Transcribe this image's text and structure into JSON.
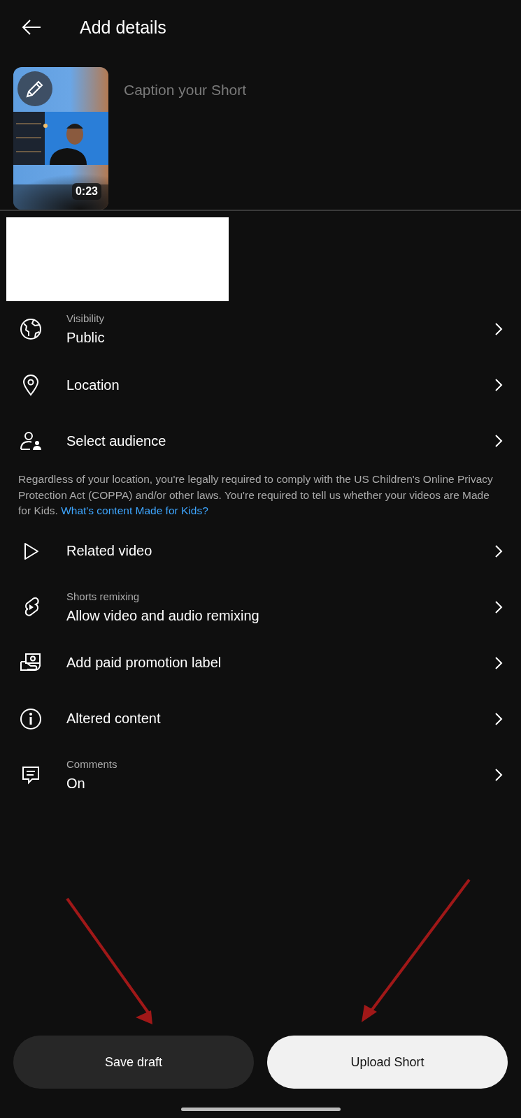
{
  "header": {
    "title": "Add details"
  },
  "video": {
    "kind": "picture",
    "duration": "0:23"
  },
  "caption": {
    "placeholder": "Caption your Short"
  },
  "settings": [
    {
      "label": "Visibility",
      "value": "Public"
    },
    {
      "value": "Location"
    },
    {
      "value": "Select audience"
    }
  ],
  "notice": {
    "text": "Regardless of your location, you're legally required to comply with the US Children's Online Privacy Protection Act (COPPA) and/or other laws. You're required to tell us whether your videos are Made for Kids.",
    "link": "What's content Made for Kids?"
  },
  "more_settings": [
    {
      "value": "Related video"
    },
    {
      "label": "Shorts remixing",
      "value": "Allow video and audio remixing"
    },
    {
      "value": "Add paid promotion label"
    },
    {
      "value": "Altered content"
    },
    {
      "label": "Comments",
      "value": "On"
    }
  ],
  "buttons": [
    {
      "label": "Save draft",
      "kind": "secondary"
    },
    {
      "label": "Upload Short",
      "kind": "primary"
    }
  ]
}
